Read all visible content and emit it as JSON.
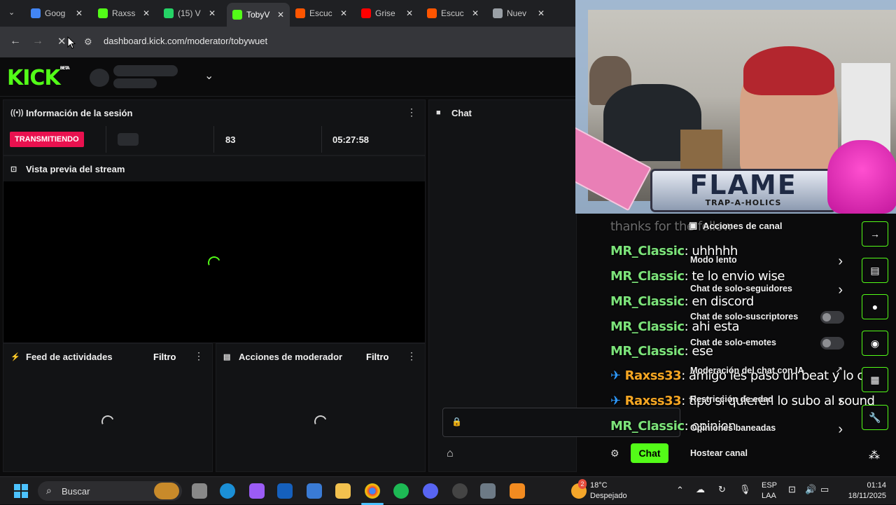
{
  "browser": {
    "tabs": [
      {
        "title": "Goog",
        "color": "#4285f4"
      },
      {
        "title": "Raxss",
        "color": "#53fc18"
      },
      {
        "title": "(15) V",
        "color": "#25d366"
      },
      {
        "title": "TobyV",
        "color": "#53fc18"
      },
      {
        "title": "Escuc",
        "color": "#ff5500"
      },
      {
        "title": "Grise",
        "color": "#ff0000"
      },
      {
        "title": "Escuc",
        "color": "#ff5500"
      },
      {
        "title": "Nuev",
        "color": "#9aa0a6"
      }
    ],
    "url": "dashboard.kick.com/moderator/tobywuet"
  },
  "kick": {
    "logo": "KICK",
    "logo_badge": "BETA"
  },
  "session": {
    "title": "Información de la sesión",
    "status": "TRANSMITIENDO",
    "viewers": "83",
    "duration": "05:27:58"
  },
  "preview": {
    "title": "Vista previa del stream"
  },
  "feed": {
    "title": "Feed de actividades",
    "filter": "Filtro"
  },
  "modactions": {
    "title": "Acciones de moderador",
    "filter": "Filtro"
  },
  "chat": {
    "title": "Chat",
    "send_label": "Chat",
    "messages": [
      {
        "user": "MR_Classic",
        "text": ": uhhhhh"
      },
      {
        "user": "MR_Classic",
        "text": ": te lo envio wise"
      },
      {
        "user": "MR_Classic",
        "text": ": en discord"
      },
      {
        "user": "MR_Classic",
        "text": ": ahi esta"
      },
      {
        "user": "MR_Classic",
        "text": ": ese"
      },
      {
        "user": "Raxss33",
        "text": ": amigo les paso un beat y lo can"
      },
      {
        "user": "Raxss33",
        "text": ": tipo si quieren lo subo al sound"
      },
      {
        "user": "MR_Classic",
        "text": ": opinion"
      }
    ],
    "partial_top": "thanks for the follow"
  },
  "channel_actions": {
    "title": "Acciones de canal",
    "items": [
      {
        "label": "Modo lento",
        "control": "chevron"
      },
      {
        "label": "Chat de solo-seguidores",
        "control": "chevron"
      },
      {
        "label": "Chat de solo-suscriptores",
        "control": "toggle"
      },
      {
        "label": "Chat de solo-emotes",
        "control": "toggle"
      },
      {
        "label": "Moderación del chat con IA",
        "control": "external"
      },
      {
        "label": "Restricción de edad",
        "control": "chevron"
      },
      {
        "label": "Opiniones baneadas",
        "control": "chevron"
      },
      {
        "label": "Hostear canal",
        "control": "none"
      }
    ]
  },
  "overlay": {
    "flame_title": "FLAME",
    "flame_subtitle": "TRAP-A-HOLICS"
  },
  "taskbar": {
    "search_placeholder": "Buscar",
    "weather_temp": "18°C",
    "weather_desc": "Despejado",
    "weather_badge": "2",
    "lang": "ESP",
    "lang_sub": "LAA",
    "time": "01:14",
    "date": "18/11/2025"
  },
  "colors": {
    "kick_green": "#53fc18",
    "live_red": "#e9114f",
    "user_green": "#7ce37a",
    "user_orange": "#f5a623"
  }
}
